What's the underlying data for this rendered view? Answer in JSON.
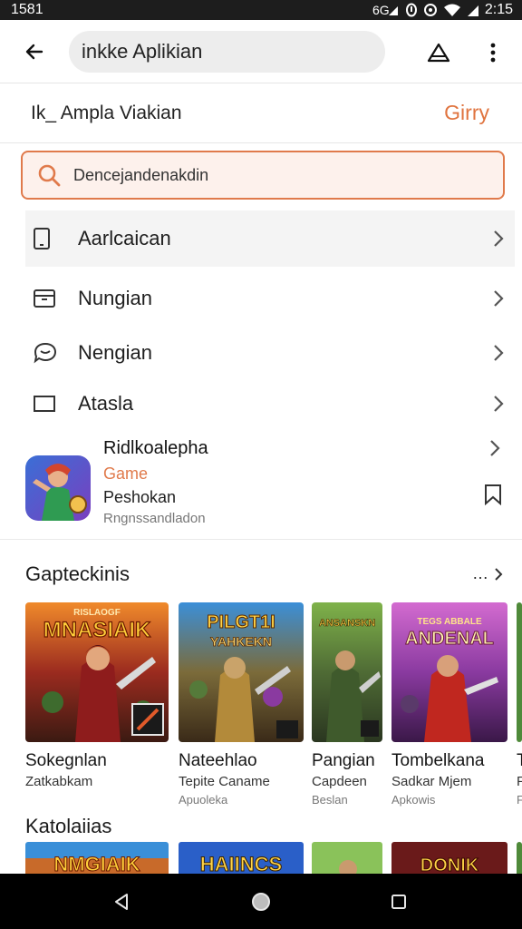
{
  "status_bar": {
    "time_left": "1581",
    "time_right": "2:15"
  },
  "app_bar": {
    "search_text": "inkke Aplikian"
  },
  "sub_header": {
    "title": "Ik_ Ampla Viakian",
    "action": "Girry"
  },
  "search_box": {
    "text": "Dencejandenakdin"
  },
  "menu": {
    "items": [
      {
        "label": "Aarlcaican",
        "icon": "tablet-icon"
      },
      {
        "label": "Nungian",
        "icon": "box-icon"
      },
      {
        "label": "Nengian",
        "icon": "chat-icon"
      },
      {
        "label": "Atasla",
        "icon": "rect-icon"
      }
    ]
  },
  "featured_app": {
    "name": "Ridlkoalepha",
    "category": "Game",
    "subtitle": "Peshokan",
    "meta": "Rngnssandladon"
  },
  "section1": {
    "title": "Gapteckinis",
    "more": "…",
    "cards": [
      {
        "title": "Sokegnlan",
        "subtitle": "Zatkabkam",
        "meta": "",
        "art_text": "MNASIAIK",
        "art_top": "RISLAOGF"
      },
      {
        "title": "Nateehlao",
        "subtitle": "Tepite Caname",
        "meta": "Apuoleka",
        "art_text": "YAHKEKN",
        "art_top": "PILGT1I"
      },
      {
        "title": "Pangian",
        "subtitle": "Capdeen",
        "meta": "Beslan",
        "art_text": "ANSANSKN",
        "art_top": ""
      },
      {
        "title": "Tombelkana",
        "subtitle": "Sadkar Mjem",
        "meta": "Apkowis",
        "art_text": "ANDENAL",
        "art_top": "TEGS ABBALE"
      },
      {
        "title": "T",
        "subtitle": "F",
        "meta": "F",
        "art_text": "",
        "art_top": ""
      }
    ]
  },
  "section2": {
    "title": "Katolaiias",
    "strips": [
      {
        "art_text": "NMGIAIK"
      },
      {
        "art_text": "HAIINCS"
      },
      {
        "art_text": ""
      },
      {
        "art_text": "DONIK"
      },
      {
        "art_text": ""
      }
    ]
  },
  "colors": {
    "accent": "#e07a4b",
    "status_bar": "#1d1d1d",
    "nav_bar": "#000000"
  }
}
